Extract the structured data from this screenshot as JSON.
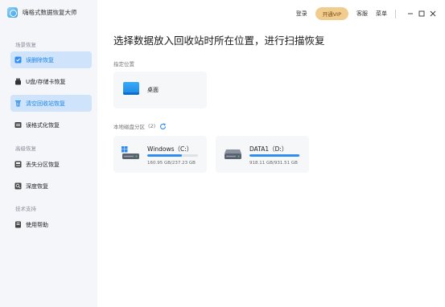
{
  "app": {
    "title": "嗨格式数据恢复大师"
  },
  "header": {
    "login": "登录",
    "vip": "开通VIP",
    "service": "客服",
    "menu": "菜单"
  },
  "sidebar": {
    "groups": [
      {
        "label": "场景恢复"
      },
      {
        "label": "高级恢复"
      },
      {
        "label": "技术支持"
      }
    ],
    "items": [
      {
        "label": "误删除恢复",
        "icon": "undo-icon",
        "active": true
      },
      {
        "label": "U盘/存储卡恢复",
        "icon": "usb-icon",
        "active": false
      },
      {
        "label": "清空回收站恢复",
        "icon": "trash-icon",
        "active": true
      },
      {
        "label": "误格式化恢复",
        "icon": "format-icon",
        "active": false
      },
      {
        "label": "丢失分区恢复",
        "icon": "partition-icon",
        "active": false
      },
      {
        "label": "深度恢复",
        "icon": "deep-scan-icon",
        "active": false
      },
      {
        "label": "使用帮助",
        "icon": "help-book-icon",
        "active": false
      }
    ]
  },
  "main": {
    "title": "选择数据放入回收站时所在位置，进行扫描恢复",
    "location_label": "指定位置",
    "desktop_label": "桌面",
    "disks_label": "本地磁盘分区",
    "disks_count": "(2)",
    "disks": [
      {
        "name": "Windows（C:）",
        "usage": "160.95 GB/237.23 GB",
        "used_fraction": 0.68,
        "windows": true
      },
      {
        "name": "DATA1（D:）",
        "usage": "918.11 GB/931.51 GB",
        "used_fraction": 0.99,
        "windows": false
      }
    ]
  },
  "colors": {
    "accent": "#2f8cf0",
    "active_bg": "#cfe3fb",
    "vip": "#f1cc8f"
  }
}
